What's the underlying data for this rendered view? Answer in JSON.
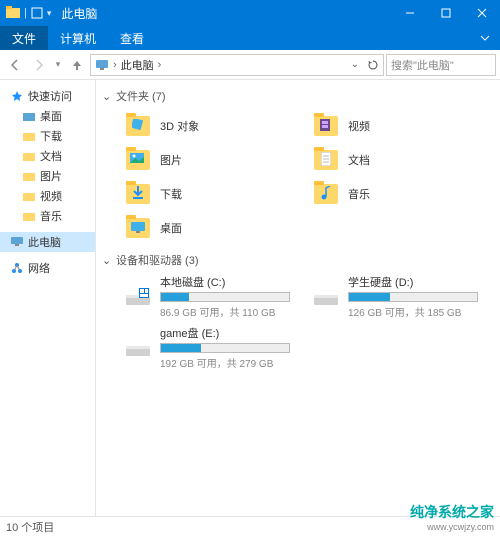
{
  "window": {
    "title": "此电脑"
  },
  "menubar": {
    "file": "文件",
    "computer": "计算机",
    "view": "查看"
  },
  "breadcrumb": {
    "current": "此电脑"
  },
  "search": {
    "placeholder": "搜索\"此电脑\""
  },
  "sidebar": {
    "quick": "快速访问",
    "items": [
      {
        "label": "桌面"
      },
      {
        "label": "下载"
      },
      {
        "label": "文档"
      },
      {
        "label": "图片"
      },
      {
        "label": "视频"
      },
      {
        "label": "音乐"
      }
    ],
    "thispc": "此电脑",
    "network": "网络"
  },
  "groups": {
    "folders": {
      "title": "文件夹 (7)"
    },
    "drives": {
      "title": "设备和驱动器 (3)"
    }
  },
  "folders": [
    {
      "label": "3D 对象"
    },
    {
      "label": "视频"
    },
    {
      "label": "图片"
    },
    {
      "label": "文档"
    },
    {
      "label": "下载"
    },
    {
      "label": "音乐"
    },
    {
      "label": "桌面"
    }
  ],
  "drives": [
    {
      "name": "本地磁盘 (C:)",
      "info": "86.9 GB 可用，共 110 GB",
      "fill": 22
    },
    {
      "name": "学生硬盘 (D:)",
      "info": "126 GB 可用，共 185 GB",
      "fill": 32
    },
    {
      "name": "game盘 (E:)",
      "info": "192 GB 可用，共 279 GB",
      "fill": 31
    }
  ],
  "statusbar": {
    "count": "10 个项目"
  },
  "watermark": {
    "main": "纯净系统之家",
    "sub": "www.ycwjzy.com"
  }
}
